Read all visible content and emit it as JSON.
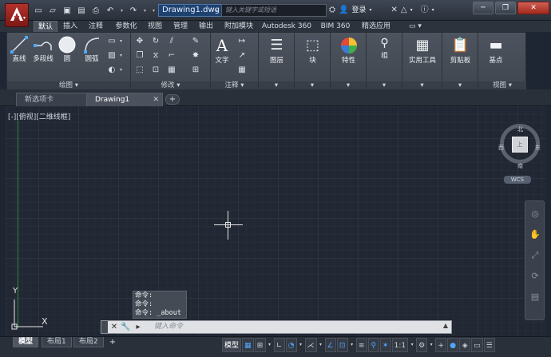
{
  "titlebar": {
    "document_title": "Drawing1.dwg",
    "search_placeholder": "键入关键字或短语",
    "login_label": "登录",
    "window_buttons": [
      "─",
      "❐",
      "✕"
    ]
  },
  "ribbon_tabs": [
    "默认",
    "插入",
    "注释",
    "参数化",
    "视图",
    "管理",
    "输出",
    "附加模块",
    "Autodesk 360",
    "BIM 360",
    "精选应用"
  ],
  "ribbon": {
    "draw": {
      "title": "绘图",
      "line": "直线",
      "polyline": "多段线",
      "circle": "圆",
      "arc": "圆弧"
    },
    "modify": {
      "title": "修改"
    },
    "annotation": {
      "title": "注释",
      "text": "文字"
    },
    "layers": {
      "label": "图层"
    },
    "block": {
      "label": "块"
    },
    "properties": {
      "label": "特性"
    },
    "groups": {
      "label": "组"
    },
    "utilities": {
      "label": "实用工具"
    },
    "clipboard": {
      "label": "剪贴板"
    },
    "view": {
      "title": "视图",
      "base": "基点"
    }
  },
  "doc_tabs": [
    {
      "label": "新选项卡"
    },
    {
      "label": "Drawing1"
    }
  ],
  "viewport": {
    "label": "[-][俯视][二维线框]",
    "viewcube": {
      "face": "上",
      "north": "北",
      "south": "南",
      "west": "西",
      "east": "东"
    },
    "wcs": "WCS",
    "ucs_y": "Y",
    "ucs_x": "X"
  },
  "command": {
    "history": [
      "命令:",
      "命令:",
      "命令: _about"
    ],
    "placeholder": "键入命令"
  },
  "layout_tabs": [
    "模型",
    "布局1",
    "布局2"
  ],
  "statusbar": {
    "model_label": "模型",
    "scale": "1:1"
  },
  "colors": {
    "accent": "#4ea8ff",
    "app_button": "#b2322c",
    "ucs_line": "#2e8b3b"
  }
}
